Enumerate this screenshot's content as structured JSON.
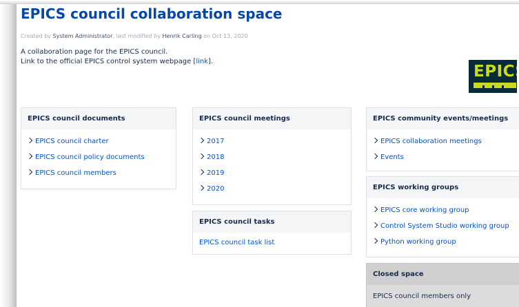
{
  "page": {
    "title": "EPICS council collaboration space",
    "byline": {
      "created_prefix": "Created by ",
      "creator": "System Administrator",
      "modified_prefix": ", last modified by ",
      "modifier": "Henrik Carling",
      "date_prefix": " on ",
      "date": "Oct 13, 2020"
    },
    "description_line1": "A collaboration page for the EPICS council.",
    "description_line2_prefix": "Link to the official EPICS control system webpage [",
    "description_link": "link",
    "description_line2_suffix": "]."
  },
  "logo": {
    "text": "EPICS"
  },
  "panels": {
    "documents": {
      "title": "EPICS council documents",
      "items": [
        "EPICS council charter",
        "EPICS council policy documents",
        "EPICS council members"
      ]
    },
    "meetings": {
      "title": "EPICS council meetings",
      "items": [
        "2017",
        "2018",
        "2019",
        "2020"
      ]
    },
    "tasks": {
      "title": "EPICS council tasks",
      "link": "EPICS council task list"
    },
    "community": {
      "title": "EPICS community events/meetings",
      "items": [
        "EPICS collaboration meetings",
        "Events"
      ]
    },
    "working_groups": {
      "title": "EPICS working groups",
      "items": [
        "EPICS core working group",
        "Control System Studio working group",
        "Python working group"
      ]
    },
    "closed": {
      "title": "Closed space",
      "body": "EPICS council members only"
    }
  },
  "colors": {
    "title": "#0747a6",
    "link": "#0052cc",
    "logo_bg": "#0a2c3a",
    "logo_fg": "#c9dc1c"
  }
}
